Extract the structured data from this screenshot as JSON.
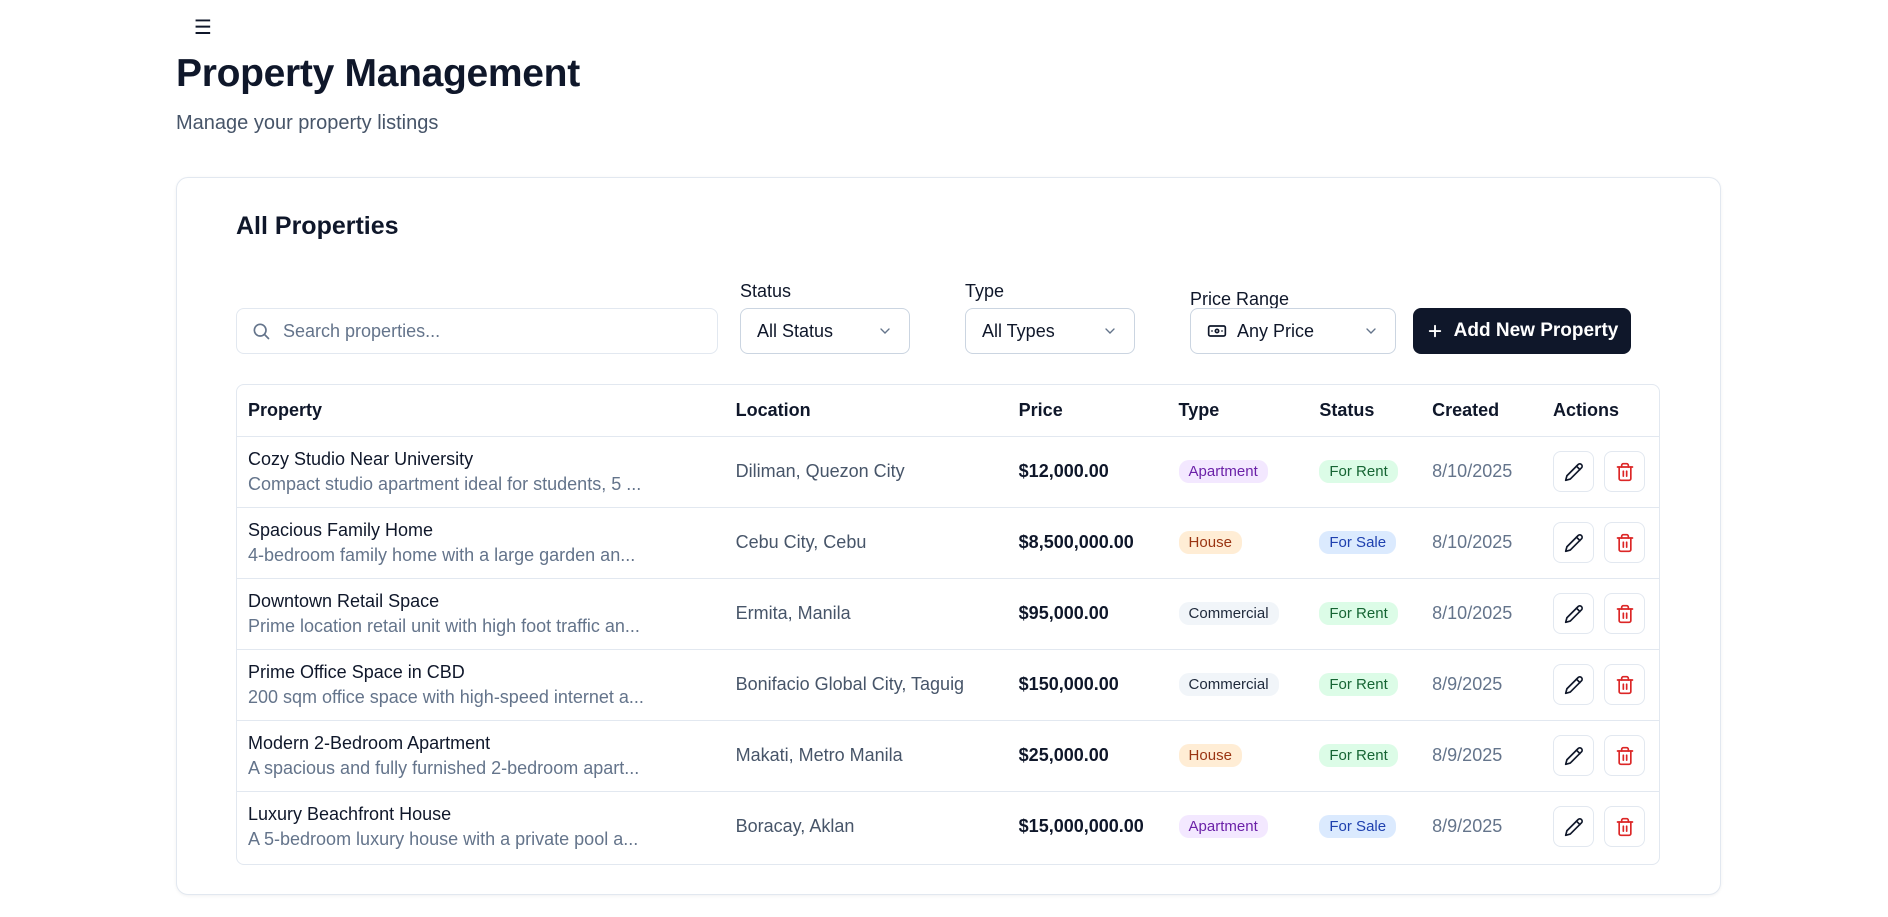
{
  "header": {
    "menu_icon": "hamburger-menu-icon",
    "title": "Property Management",
    "subtitle": "Manage your property listings"
  },
  "card": {
    "title": "All Properties"
  },
  "filters": {
    "search_placeholder": "Search properties...",
    "status_label": "Status",
    "status_value": "All Status",
    "type_label": "Type",
    "type_value": "All Types",
    "price_label": "Price Range",
    "price_value": "Any Price",
    "add_button": "Add New Property"
  },
  "table": {
    "columns": [
      "Property",
      "Location",
      "Price",
      "Type",
      "Status",
      "Created",
      "Actions"
    ],
    "rows": [
      {
        "name": "Cozy Studio Near University",
        "desc": "Compact studio apartment ideal for students, 5 ...",
        "location": "Diliman, Quezon City",
        "price": "$12,000.00",
        "type": "Apartment",
        "status": "For Rent",
        "created": "8/10/2025"
      },
      {
        "name": "Spacious Family Home",
        "desc": "4-bedroom family home with a large garden an...",
        "location": "Cebu City, Cebu",
        "price": "$8,500,000.00",
        "type": "House",
        "status": "For Sale",
        "created": "8/10/2025"
      },
      {
        "name": "Downtown Retail Space",
        "desc": "Prime location retail unit with high foot traffic an...",
        "location": "Ermita, Manila",
        "price": "$95,000.00",
        "type": "Commercial",
        "status": "For Rent",
        "created": "8/10/2025"
      },
      {
        "name": "Prime Office Space in CBD",
        "desc": "200 sqm office space with high-speed internet a...",
        "location": "Bonifacio Global City, Taguig",
        "price": "$150,000.00",
        "type": "Commercial",
        "status": "For Rent",
        "created": "8/9/2025"
      },
      {
        "name": "Modern 2-Bedroom Apartment",
        "desc": "A spacious and fully furnished 2-bedroom apart...",
        "location": "Makati, Metro Manila",
        "price": "$25,000.00",
        "type": "House",
        "status": "For Rent",
        "created": "8/9/2025"
      },
      {
        "name": "Luxury Beachfront House",
        "desc": "A 5-bedroom luxury house with a private pool a...",
        "location": "Boracay, Aklan",
        "price": "$15,000,000.00",
        "type": "Apartment",
        "status": "For Sale",
        "created": "8/9/2025"
      }
    ]
  },
  "colors": {
    "primary": "#0f172a",
    "apartment_bg": "#f3e8ff",
    "apartment_fg": "#6b21a8",
    "house_bg": "#ffedd5",
    "house_fg": "#9a3412",
    "commercial_bg": "#f1f5f9",
    "commercial_fg": "#1e293b",
    "rent_bg": "#dcfce7",
    "rent_fg": "#166534",
    "sale_bg": "#dbeafe",
    "sale_fg": "#1e40af",
    "delete": "#dc2626"
  }
}
